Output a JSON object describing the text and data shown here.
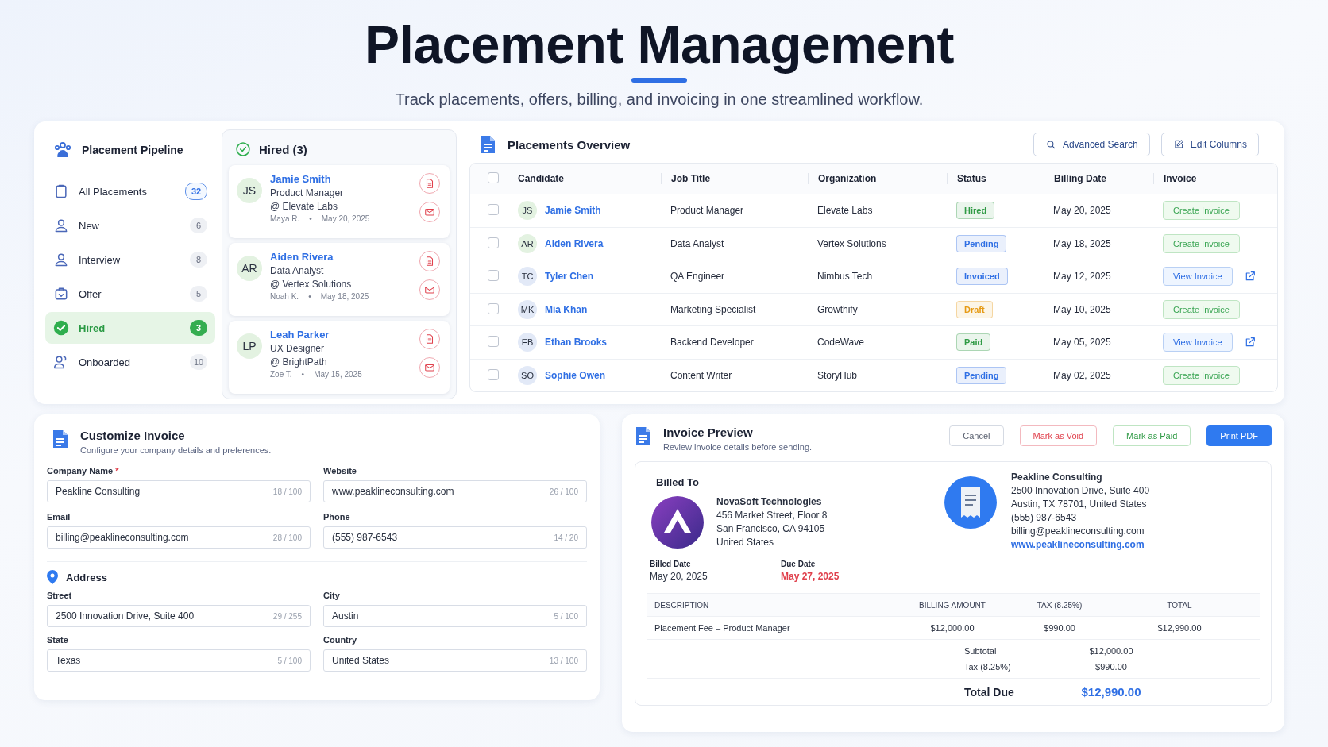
{
  "header": {
    "title": "Placement Management",
    "subtitle": "Track placements, offers, billing, and invoicing in one streamlined workflow."
  },
  "pipeline": {
    "title": "Placement Pipeline",
    "items": [
      {
        "label": "All Placements",
        "count": "32",
        "kind": "total",
        "selected": false
      },
      {
        "label": "New",
        "count": "6",
        "kind": "stage",
        "selected": false
      },
      {
        "label": "Interview",
        "count": "8",
        "kind": "stage",
        "selected": false
      },
      {
        "label": "Offer",
        "count": "5",
        "kind": "stage",
        "selected": false
      },
      {
        "label": "Hired",
        "count": "3",
        "kind": "stage",
        "selected": true
      },
      {
        "label": "Onboarded",
        "count": "10",
        "kind": "stage",
        "selected": false
      }
    ]
  },
  "hired_column": {
    "title": "Hired (3)",
    "cards": [
      {
        "initials": "JS",
        "name": "Jamie Smith",
        "role": "Product Manager",
        "company": "@ Elevate Labs",
        "recruiter": "Maya R.",
        "separator": "•",
        "date": "May 20, 2025"
      },
      {
        "initials": "AR",
        "name": "Aiden Rivera",
        "role": "Data Analyst",
        "company": "@ Vertex Solutions",
        "recruiter": "Noah K.",
        "separator": "•",
        "date": "May 18, 2025"
      },
      {
        "initials": "LP",
        "name": "Leah Parker",
        "role": "UX Designer",
        "company": "@ BrightPath",
        "recruiter": "Zoe T.",
        "separator": "•",
        "date": "May 15, 2025"
      }
    ]
  },
  "overview": {
    "title": "Placements Overview",
    "buttons": [
      "Advanced Search",
      "Edit Columns"
    ],
    "table": {
      "select_all_checked": false,
      "columns": [
        "Candidate",
        "Job Title",
        "Organization",
        "Status",
        "Billing Date",
        "Invoice"
      ],
      "rows": [
        {
          "checked": false,
          "avatar": {
            "initials": "JS",
            "color": "#e3f2e1"
          },
          "candidate": "Jamie Smith",
          "job_title": "Product Manager",
          "organization": "Elevate Labs",
          "status": {
            "label": "Hired",
            "color": "#2f9a45"
          },
          "billing_date": "May 20, 2025",
          "invoice": {
            "label": "Create Invoice",
            "kind": "create"
          }
        },
        {
          "checked": false,
          "avatar": {
            "initials": "AR",
            "color": "#e3f2e1"
          },
          "candidate": "Aiden Rivera",
          "job_title": "Data Analyst",
          "organization": "Vertex Solutions",
          "status": {
            "label": "Pending",
            "color": "#2f6fe4"
          },
          "billing_date": "May 18, 2025",
          "invoice": {
            "label": "Create Invoice",
            "kind": "create"
          }
        },
        {
          "checked": false,
          "avatar": {
            "initials": "TC",
            "color": "#e2e9f7"
          },
          "candidate": "Tyler Chen",
          "job_title": "QA Engineer",
          "organization": "Nimbus Tech",
          "status": {
            "label": "Invoiced",
            "color": "#2f6fe4"
          },
          "billing_date": "May 12, 2025",
          "invoice": {
            "label": "View Invoice",
            "kind": "view"
          }
        },
        {
          "checked": false,
          "avatar": {
            "initials": "MK",
            "color": "#e2e9f7"
          },
          "candidate": "Mia Khan",
          "job_title": "Marketing Specialist",
          "organization": "Growthify",
          "status": {
            "label": "Draft",
            "color": "#e69a14"
          },
          "billing_date": "May 10, 2025",
          "invoice": {
            "label": "Create Invoice",
            "kind": "create"
          }
        },
        {
          "checked": false,
          "avatar": {
            "initials": "EB",
            "color": "#e2e9f7"
          },
          "candidate": "Ethan Brooks",
          "job_title": "Backend Developer",
          "organization": "CodeWave",
          "status": {
            "label": "Paid",
            "color": "#2f9a45"
          },
          "billing_date": "May 05, 2025",
          "invoice": {
            "label": "View Invoice",
            "kind": "view"
          }
        },
        {
          "checked": false,
          "avatar": {
            "initials": "SO",
            "color": "#e2e9f7"
          },
          "candidate": "Sophie Owen",
          "job_title": "Content Writer",
          "organization": "StoryHub",
          "status": {
            "label": "Pending",
            "color": "#2f6fe4"
          },
          "billing_date": "May 02, 2025",
          "invoice": {
            "label": "Create Invoice",
            "kind": "create"
          }
        }
      ]
    }
  },
  "customize": {
    "title": "Customize Invoice",
    "subtitle": "Configure your company details and preferences.",
    "fields": [
      {
        "label": "Company Name",
        "required_mark": "*",
        "value": "Peakline Consulting",
        "counter": "18 / 100"
      },
      {
        "label": "Website",
        "value": "www.peaklineconsulting.com",
        "counter": "26 / 100"
      },
      {
        "label": "Email",
        "value": "billing@peaklineconsulting.com",
        "counter": "28 / 100"
      },
      {
        "label": "Phone",
        "value": "(555) 987-6543",
        "counter": "14 / 20"
      }
    ],
    "address_title": "Address",
    "address_fields": [
      {
        "label": "Street",
        "value": "2500 Innovation Drive, Suite 400",
        "counter": "29 / 255"
      },
      {
        "label": "City",
        "value": "Austin",
        "counter": "5 / 100"
      },
      {
        "label": "State",
        "value": "Texas",
        "counter": "5 / 100"
      },
      {
        "label": "Country",
        "value": "United States",
        "counter": "13 / 100"
      }
    ]
  },
  "preview": {
    "title": "Invoice Preview",
    "subtitle": "Review invoice details before sending.",
    "buttons": [
      {
        "label": "Cancel",
        "kind": "neutral"
      },
      {
        "label": "Mark as Void",
        "kind": "danger"
      },
      {
        "label": "Mark as Paid",
        "kind": "success"
      },
      {
        "label": "Print PDF",
        "kind": "primary"
      }
    ],
    "billed_to_title": "Billed To",
    "client": {
      "name": "NovaSoft Technologies",
      "lines": [
        "456 Market Street, Floor 8",
        "San Francisco, CA 94105",
        "United States"
      ]
    },
    "billed_date": {
      "label": "Billed Date",
      "value": "May 20, 2025"
    },
    "due_date": {
      "label": "Due Date",
      "value": "May 27, 2025"
    },
    "company": {
      "name": "Peakline Consulting",
      "lines": [
        "2500 Innovation Drive, Suite 400",
        "Austin, TX 78701, United States",
        "(555) 987-6543",
        "billing@peaklineconsulting.com"
      ],
      "website": "www.peaklineconsulting.com"
    },
    "table": {
      "columns": [
        "DESCRIPTION",
        "BILLING AMOUNT",
        "TAX (8.25%)",
        "TOTAL"
      ],
      "rows": [
        [
          "Placement Fee – Product Manager",
          "$12,000.00",
          "$990.00",
          "$12,990.00"
        ]
      ]
    },
    "summary": [
      {
        "label": "Subtotal",
        "value": "$12,000.00"
      },
      {
        "label": "Tax (8.25%)",
        "value": "$990.00"
      }
    ],
    "total": {
      "label": "Total Due",
      "value": "$12,990.00"
    }
  }
}
